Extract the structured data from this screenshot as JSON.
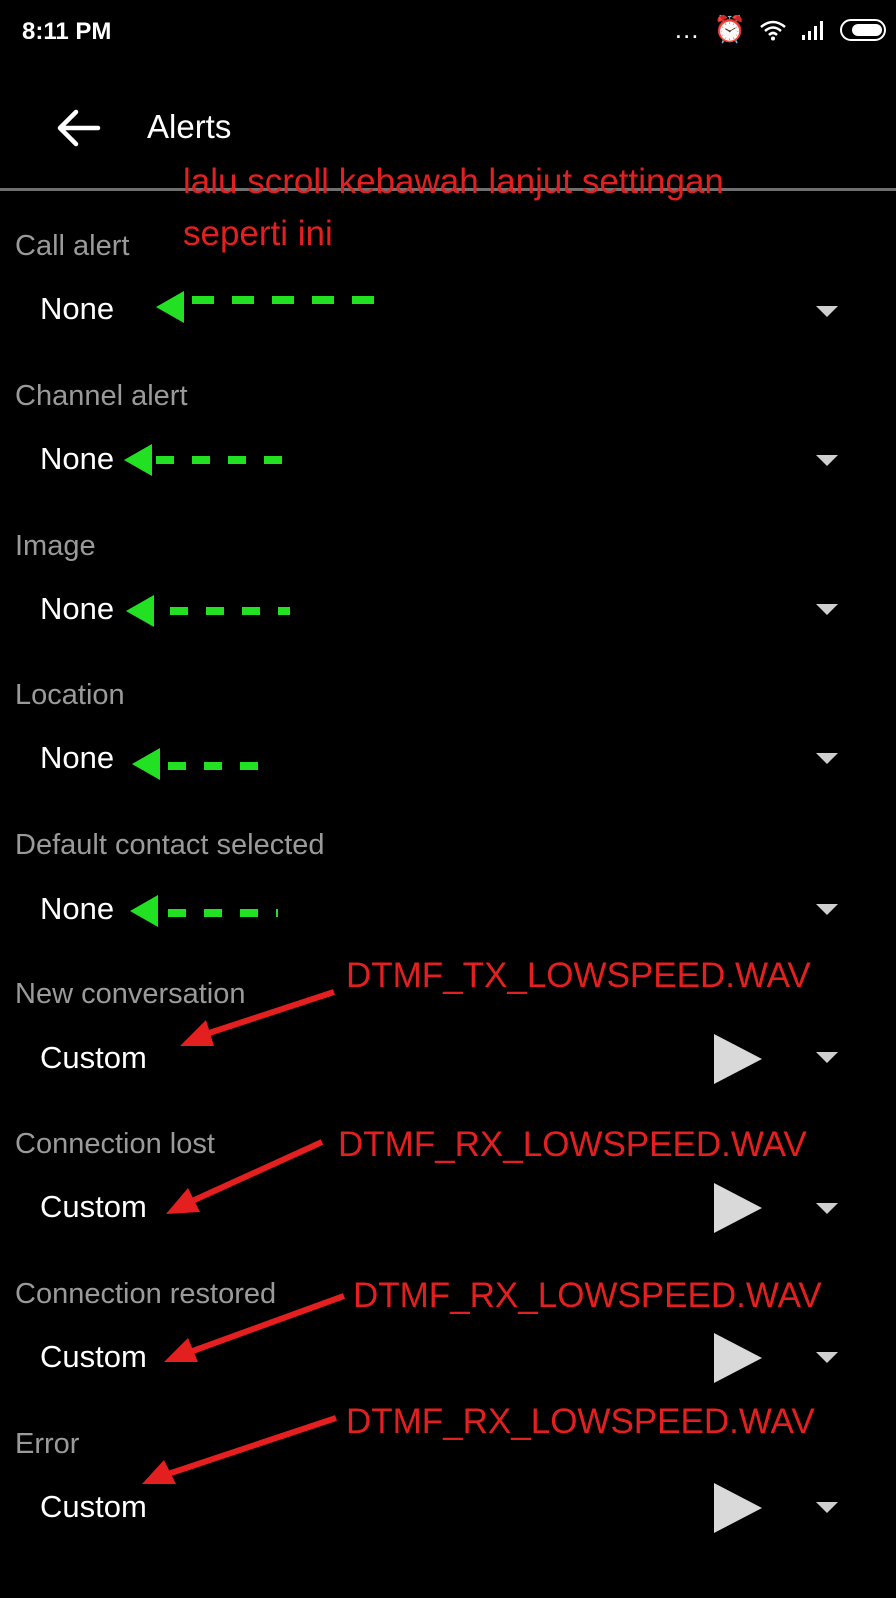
{
  "status_bar": {
    "time": "8:11 PM",
    "icons": [
      "more-icon",
      "alarm-icon",
      "wifi-icon",
      "signal-icon",
      "battery-icon"
    ]
  },
  "header": {
    "title": "Alerts"
  },
  "rows": [
    {
      "label": "Call alert",
      "value": "None",
      "has_play": false
    },
    {
      "label": "Channel alert",
      "value": "None",
      "has_play": false
    },
    {
      "label": "Image",
      "value": "None",
      "has_play": false
    },
    {
      "label": "Location",
      "value": "None",
      "has_play": false
    },
    {
      "label": "Default contact selected",
      "value": "None",
      "has_play": false
    },
    {
      "label": "New conversation",
      "value": "Custom",
      "has_play": true
    },
    {
      "label": "Connection lost",
      "value": "Custom",
      "has_play": true
    },
    {
      "label": "Connection restored",
      "value": "Custom",
      "has_play": true
    },
    {
      "label": "Error",
      "value": "Custom",
      "has_play": true
    }
  ],
  "annotations": {
    "intro_line1": "lalu scroll kebawah lanjut settingan",
    "intro_line2": "seperti ini",
    "new_conversation_file": "DTMF_TX_LOWSPEED.WAV",
    "connection_lost_file": "DTMF_RX_LOWSPEED.WAV",
    "connection_restored_file": "DTMF_RX_LOWSPEED.WAV",
    "error_file": "DTMF_RX_LOWSPEED.WAV"
  },
  "colors": {
    "background": "#000000",
    "label": "#9a9a9a",
    "value": "#ffffff",
    "annotation_red": "#e41f1f",
    "annotation_green": "#22e122"
  }
}
